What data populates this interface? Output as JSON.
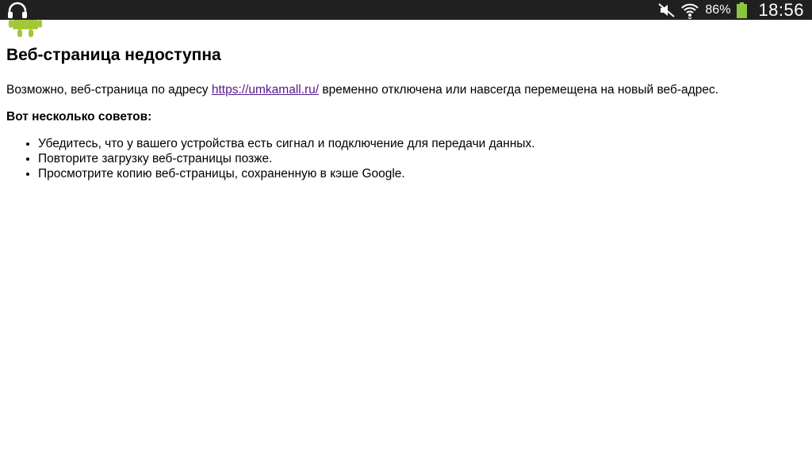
{
  "status_bar": {
    "battery_percent": "86%",
    "time": "18:56",
    "icons": [
      "headphones-icon",
      "mute-icon",
      "wifi-icon",
      "battery-icon"
    ],
    "battery_color": "#8cc63f"
  },
  "page": {
    "title": "Веб-страница недоступна",
    "intro_before": "Возможно, веб-страница по адресу ",
    "url": "https://umkamall.ru/",
    "intro_after": " временно отключена или навсегда перемещена на новый веб-адрес.",
    "tips_title": "Вот несколько советов:",
    "tips": [
      "Убедитесь, что у вашего устройства есть сигнал и подключение для передачи данных.",
      "Повторите загрузку веб-страницы позже.",
      "Просмотрите копию веб-страницы, сохраненную в кэше Google."
    ],
    "link_color": "#551a8b"
  }
}
